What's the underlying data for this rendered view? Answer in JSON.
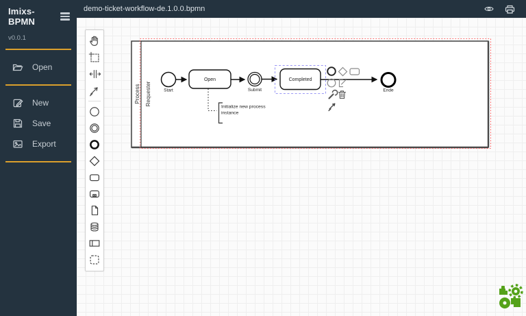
{
  "app": {
    "title": "Imixs-BPMN",
    "version": "v0.0.1",
    "menu_toggle_icon": "menu-icon"
  },
  "topbar": {
    "filename": "demo-ticket-workflow-de.1.0.0.bpmn",
    "icons": [
      "eye-preview-icon",
      "print-icon"
    ]
  },
  "sidebar": {
    "items": [
      {
        "label": "Open",
        "icon": "folder-open-icon"
      },
      {
        "label": "New",
        "icon": "edit-icon"
      },
      {
        "label": "Save",
        "icon": "save-icon"
      },
      {
        "label": "Export",
        "icon": "image-export-icon"
      }
    ]
  },
  "palette": {
    "tools": [
      "hand-tool",
      "lasso-tool",
      "space-tool",
      "global-connect-tool",
      "create-start-event",
      "create-intermediate-event",
      "create-end-event",
      "create-gateway",
      "create-task",
      "create-subprocess",
      "create-data-object",
      "create-data-store",
      "create-participant",
      "create-group"
    ]
  },
  "diagram": {
    "pool_label": "Process",
    "lane_label": "Requester",
    "nodes": [
      {
        "label": "Start",
        "type": "start-event"
      },
      {
        "label": "Open",
        "type": "task"
      },
      {
        "label": "Submit",
        "type": "intermediate-catch-event"
      },
      {
        "label": "Completed",
        "type": "task",
        "selected": true
      },
      {
        "label": "Ende",
        "type": "end-event"
      }
    ],
    "annotation": {
      "line1": "Initialize new process",
      "line2": "instance"
    },
    "context_pad": [
      "append-end-event",
      "append-gateway",
      "append-task",
      "append-intermediate-event",
      "append-text-annotation",
      "wrench-change-type",
      "trash-delete",
      "connect-arrow"
    ]
  },
  "colors": {
    "sidebar_bg": "#24333f",
    "accent_gold": "#dba02c",
    "selection_red": "#ff5c5c",
    "selection_blue": "#9a97f5",
    "logo_green": "#55a21a"
  }
}
